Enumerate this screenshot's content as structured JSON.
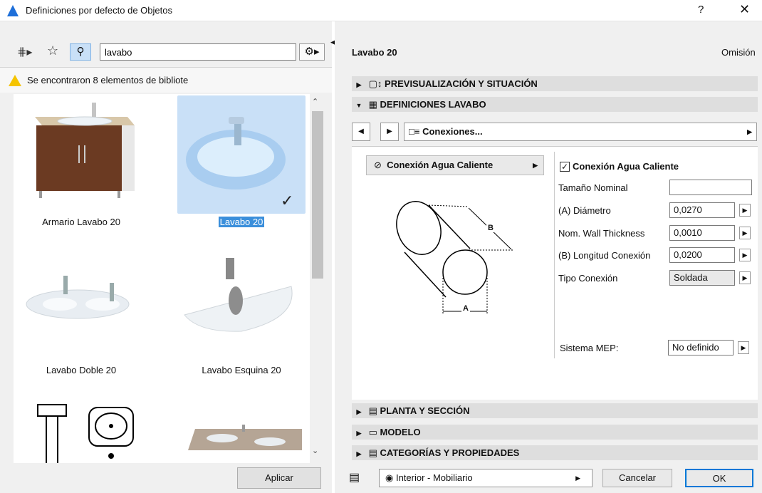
{
  "window": {
    "title": "Definiciones por defecto de Objetos",
    "help": "?",
    "close": "✕"
  },
  "search": {
    "value": "lavabo"
  },
  "results_message": "Se encontraron 8 elementos de bibliote",
  "gallery": {
    "items": [
      {
        "label": "Armario Lavabo 20",
        "selected": false
      },
      {
        "label": "Lavabo 20",
        "selected": true
      },
      {
        "label": "Lavabo Doble 20",
        "selected": false
      },
      {
        "label": "Lavabo Esquina 20",
        "selected": false
      }
    ]
  },
  "apply_label": "Aplicar",
  "object": {
    "name": "Lavabo 20",
    "default_label": "Omisión"
  },
  "sections": {
    "preview": "PREVISUALIZACIÓN Y SITUACIÓN",
    "settings": "DEFINICIONES LAVABO",
    "plan": "PLANTA Y SECCIÓN",
    "model": "MODELO",
    "categories": "CATEGORÍAS Y PROPIEDADES"
  },
  "page_selector": "Conexiones...",
  "connection_selector": "Conexión Agua Caliente",
  "diagram": {
    "label_a": "A",
    "label_b": "B"
  },
  "params": {
    "checkbox_label": "Conexión Agua Caliente",
    "checkbox_checked": true,
    "rows": [
      {
        "label": "Tamaño Nominal",
        "value": ""
      },
      {
        "label": "(A) Diámetro",
        "value": "0,0270"
      },
      {
        "label": "Nom. Wall Thickness",
        "value": "0,0010"
      },
      {
        "label": "(B) Longitud Conexión",
        "value": "0,0200"
      },
      {
        "label": "Tipo Conexión",
        "value": "Soldada"
      }
    ],
    "mep_label": "Sistema MEP:",
    "mep_value": "No definido"
  },
  "footer": {
    "layer": "Interior - Mobiliario",
    "cancel": "Cancelar",
    "ok": "OK"
  },
  "colors": {
    "accent": "#1e6fd9",
    "selection": "#c9e0f7",
    "ok_border": "#0078d7"
  }
}
